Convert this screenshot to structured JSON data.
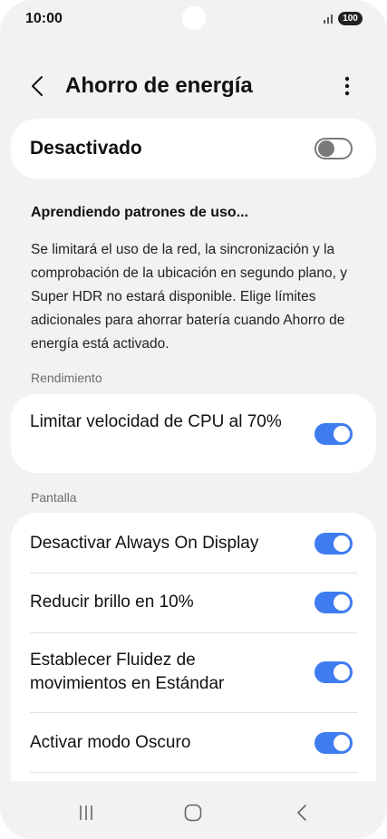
{
  "status_bar": {
    "time": "10:00",
    "battery": "100"
  },
  "header": {
    "title": "Ahorro de energía"
  },
  "master": {
    "label": "Desactivado",
    "state": "off"
  },
  "learning": {
    "title": "Aprendiendo patrones de uso...",
    "description": "Se limitará el uso de la red, la sincronización y la comprobación de la ubicación en segundo plano, y Super HDR no estará disponible. Elige límites adicionales para ahorrar batería cuando Ahorro de energía está activado."
  },
  "performance": {
    "header": "Rendimiento",
    "items": [
      {
        "label": "Limitar velocidad de CPU al 70%",
        "state": "on"
      }
    ]
  },
  "screen": {
    "header": "Pantalla",
    "items": [
      {
        "label": "Desactivar Always On Display",
        "state": "on"
      },
      {
        "label": "Reducir brillo en 10%",
        "state": "on"
      },
      {
        "label": "Establecer Fluidez de movimientos en Estándar",
        "state": "on"
      },
      {
        "label": "Activar modo Oscuro",
        "state": "on"
      }
    ]
  },
  "colors": {
    "toggle_on": "#3e7cf0",
    "toggle_off": "#7a7a7a",
    "background": "#f2f2f4",
    "card": "#ffffff"
  },
  "icons": {
    "back": "chevron-left-icon",
    "more": "more-vertical-icon",
    "nav_recents": "recents-icon",
    "nav_home": "home-icon",
    "nav_back": "back-icon"
  }
}
